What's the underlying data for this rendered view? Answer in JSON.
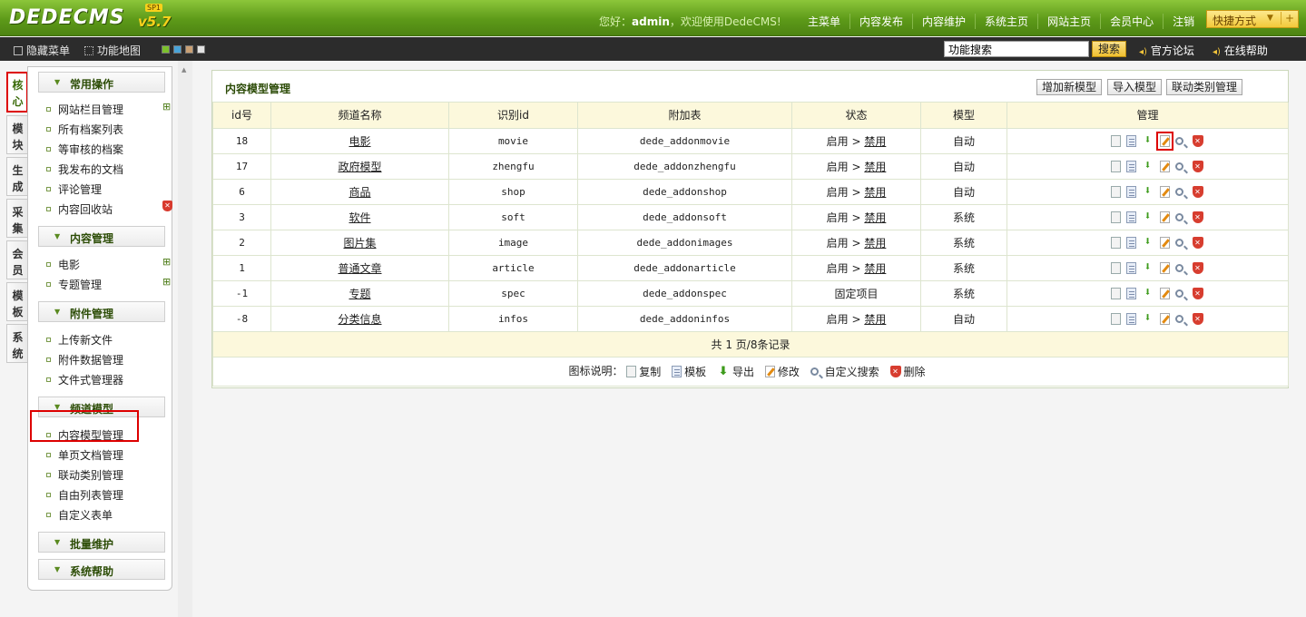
{
  "header": {
    "logo": "DEDECMS",
    "version": "v5.7",
    "badge": "SP1",
    "welcome_prefix": "您好：",
    "user": "admin",
    "welcome_suffix": "，欢迎使用DedeCMS!",
    "nav": [
      "主菜单",
      "内容发布",
      "内容维护",
      "系统主页",
      "网站主页",
      "会员中心",
      "注销"
    ],
    "quick": "快捷方式"
  },
  "toolbar": {
    "hide_menu": "隐藏菜单",
    "sitemap": "功能地图",
    "swatches": [
      "#7cc12c",
      "#49a3d8",
      "#c9a074",
      "#e3e3e3"
    ],
    "search_value": "功能搜索",
    "search_btn": "搜索",
    "forum": "官方论坛",
    "help": "在线帮助"
  },
  "vtabs": [
    "核心",
    "模块",
    "生成",
    "采集",
    "会员",
    "模板",
    "系统"
  ],
  "sidebar": {
    "groups": [
      "常用操作",
      "内容管理",
      "附件管理",
      "频道模型",
      "批量维护",
      "系统帮助"
    ],
    "common": [
      "网站栏目管理",
      "所有档案列表",
      "等审核的档案",
      "我发布的文档",
      "评论管理",
      "内容回收站"
    ],
    "content": [
      "电影",
      "专题管理"
    ],
    "attach": [
      "上传新文件",
      "附件数据管理",
      "文件式管理器"
    ],
    "channel": [
      "内容模型管理",
      "单页文档管理",
      "联动类别管理",
      "自由列表管理",
      "自定义表单"
    ]
  },
  "panel": {
    "title": "内容模型管理",
    "btn_add": "增加新模型",
    "btn_import": "导入模型",
    "btn_linkage": "联动类别管理",
    "columns": [
      "id号",
      "频道名称",
      "识别id",
      "附加表",
      "状态",
      "模型",
      "管理"
    ],
    "rows": [
      {
        "id": "18",
        "name": "电影",
        "nid": "movie",
        "table": "dede_addonmovie",
        "status": "启用 > ",
        "status_link": "禁用",
        "model": "自动"
      },
      {
        "id": "17",
        "name": "政府模型",
        "nid": "zhengfu",
        "table": "dede_addonzhengfu",
        "status": "启用 > ",
        "status_link": "禁用",
        "model": "自动"
      },
      {
        "id": "6",
        "name": "商品",
        "nid": "shop",
        "table": "dede_addonshop",
        "status": "启用 > ",
        "status_link": "禁用",
        "model": "自动"
      },
      {
        "id": "3",
        "name": "软件",
        "nid": "soft",
        "table": "dede_addonsoft",
        "status": "启用 > ",
        "status_link": "禁用",
        "model": "系统"
      },
      {
        "id": "2",
        "name": "图片集",
        "nid": "image",
        "table": "dede_addonimages",
        "status": "启用 > ",
        "status_link": "禁用",
        "model": "系统"
      },
      {
        "id": "1",
        "name": "普通文章",
        "nid": "article",
        "table": "dede_addonarticle",
        "status": "启用 > ",
        "status_link": "禁用",
        "model": "系统"
      },
      {
        "id": "-1",
        "name": "专题",
        "nid": "spec",
        "table": "dede_addonspec",
        "status": "固定项目",
        "status_link": "",
        "model": "系统"
      },
      {
        "id": "-8",
        "name": "分类信息",
        "nid": "infos",
        "table": "dede_addoninfos",
        "status": "启用 > ",
        "status_link": "禁用",
        "model": "自动"
      }
    ],
    "pager": "共 1 页/8条记录",
    "legend_title": "图标说明：",
    "legend": [
      "复制",
      "模板",
      "导出",
      "修改",
      "自定义搜索",
      "删除"
    ]
  }
}
